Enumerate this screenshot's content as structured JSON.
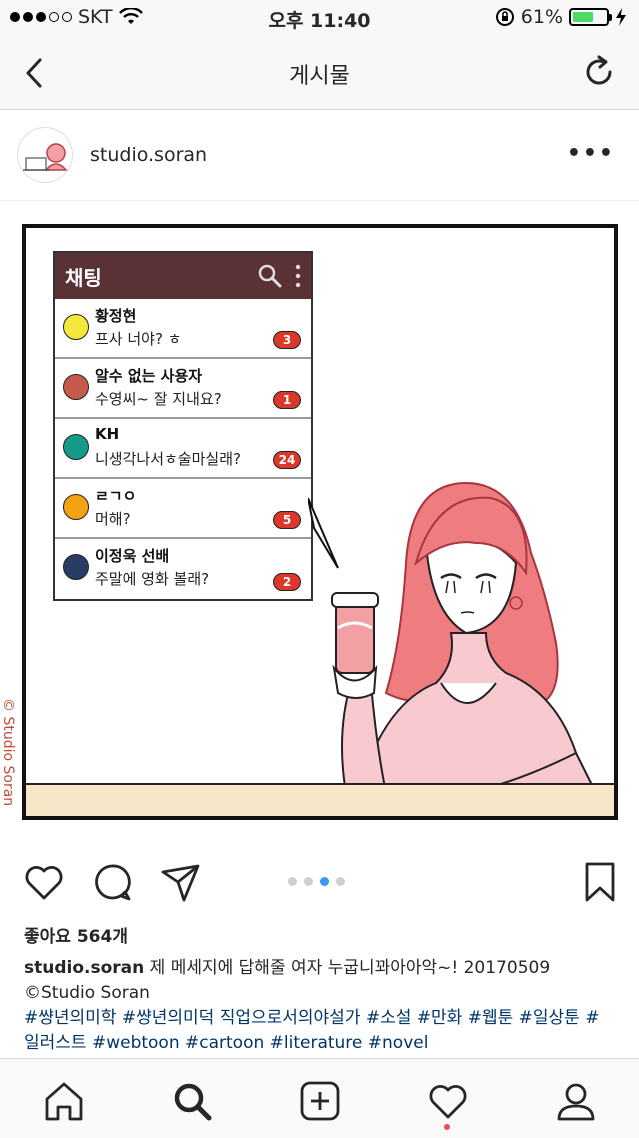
{
  "status_bar": {
    "carrier": "SKT",
    "time": "오후 11:40",
    "battery": "61%",
    "battery_level": 0.61
  },
  "nav": {
    "title": "게시물"
  },
  "post": {
    "username": "studio.soran",
    "more_label": "•••"
  },
  "comic": {
    "watermark": "© Studio Soran",
    "chat_title": "채팅",
    "chats": [
      {
        "name": "황정현",
        "message": "프사 너야? ㅎ",
        "unread": "3",
        "color": "#f6e73c"
      },
      {
        "name": "알수 없는 사용자",
        "message": "수영씨~ 잘 지내요?",
        "unread": "1",
        "color": "#c85a4d"
      },
      {
        "name": "KH",
        "message": "니생각나서ㅎ술마실래?",
        "unread": "24",
        "color": "#169a8a"
      },
      {
        "name": "ㄹㄱㅇ",
        "message": "머해?",
        "unread": "5",
        "color": "#f5a114"
      },
      {
        "name": "이정욱 선배",
        "message": "주말에 영화 볼래?",
        "unread": "2",
        "color": "#273b63"
      }
    ]
  },
  "carousel": {
    "count": 4,
    "active_index": 2
  },
  "likes": "좋아요 564개",
  "caption": {
    "username": "studio.soran",
    "text": " 제 메세지에 답해줄 여자 누굽니꽈아아악~! 20170509",
    "line2": "©Studio Soran",
    "tags": "#썅년의미학 #썅년의미덕 직업으로서의야설가 #소설 #만화 #웹툰 #일상툰 #일러스트 #webtoon #cartoon #literature #novel"
  },
  "colors": {
    "accent": "#3897f0",
    "chat_header": "#5a3236",
    "badge": "#d9382a",
    "hashtag": "#003569"
  }
}
